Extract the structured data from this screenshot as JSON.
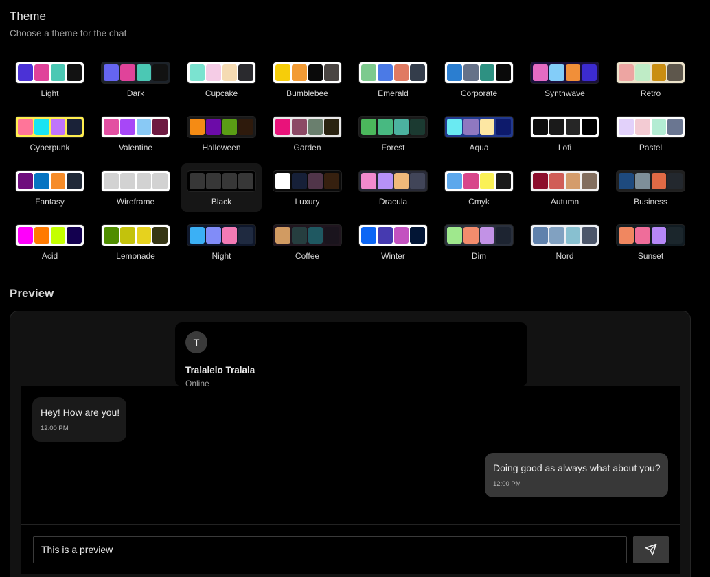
{
  "header": {
    "title": "Theme",
    "subtitle": "Choose a theme for the chat"
  },
  "themes": [
    {
      "name": "Light",
      "colors": [
        "#4b32d6",
        "#e0439a",
        "#4bc8b4",
        "#121212"
      ],
      "frame": "#ffffff"
    },
    {
      "name": "Dark",
      "colors": [
        "#6565f0",
        "#e0439a",
        "#4bc8b4",
        "#121212"
      ],
      "frame": "#1d232a"
    },
    {
      "name": "Cupcake",
      "colors": [
        "#7be3d0",
        "#f5cce6",
        "#f5dbb3",
        "#2a2a2e"
      ],
      "frame": "#ffffff"
    },
    {
      "name": "Bumblebee",
      "colors": [
        "#f6cd0a",
        "#f29b35",
        "#0a0a0a",
        "#4a4542"
      ],
      "frame": "#ffffff"
    },
    {
      "name": "Emerald",
      "colors": [
        "#7dca8e",
        "#4b7ae6",
        "#e07a62",
        "#343d4b"
      ],
      "frame": "#ffffff"
    },
    {
      "name": "Corporate",
      "colors": [
        "#2b7ed0",
        "#667289",
        "#2e9182",
        "#0a0a0a"
      ],
      "frame": "#ffffff"
    },
    {
      "name": "Synthwave",
      "colors": [
        "#e46bc3",
        "#83cdf9",
        "#f18f39",
        "#3c2bd0"
      ],
      "frame": "#1a103c"
    },
    {
      "name": "Retro",
      "colors": [
        "#eda5a2",
        "#bfecc6",
        "#c98d12",
        "#5e574c"
      ],
      "frame": "#ece3ca"
    },
    {
      "name": "Cyberpunk",
      "colors": [
        "#ff7599",
        "#19e3f2",
        "#c074fb",
        "#1a2238"
      ],
      "frame": "#ffee4f"
    },
    {
      "name": "Valentine",
      "colors": [
        "#e34fa2",
        "#a747f7",
        "#89c9f5",
        "#6e1a41"
      ],
      "frame": "#ffffff"
    },
    {
      "name": "Halloween",
      "colors": [
        "#f58b14",
        "#6c0ba8",
        "#5a9d15",
        "#2e1a0c"
      ],
      "frame": "#1a1a1a"
    },
    {
      "name": "Garden",
      "colors": [
        "#e9127a",
        "#8c4965",
        "#6a7f6e",
        "#2a2311"
      ],
      "frame": "#e8e8e8"
    },
    {
      "name": "Forest",
      "colors": [
        "#4bb85c",
        "#48b981",
        "#4cb2a0",
        "#1b3a31"
      ],
      "frame": "#1a1a1a"
    },
    {
      "name": "Aqua",
      "colors": [
        "#6aeaf2",
        "#9078c0",
        "#fde7a3",
        "#0d1a6b"
      ],
      "frame": "#22398d"
    },
    {
      "name": "Lofi",
      "colors": [
        "#0d0d0d",
        "#1a1a1a",
        "#262626",
        "#000000"
      ],
      "frame": "#ffffff"
    },
    {
      "name": "Pastel",
      "colors": [
        "#e2d1fa",
        "#f3cbd3",
        "#b3ecd3",
        "#6a7691"
      ],
      "frame": "#ffffff"
    },
    {
      "name": "Fantasy",
      "colors": [
        "#6e0e7d",
        "#0674c2",
        "#f68c29",
        "#202938"
      ],
      "frame": "#ffffff"
    },
    {
      "name": "Wireframe",
      "colors": [
        "#d2d2d2",
        "#d2d2d2",
        "#d2d2d2",
        "#d2d2d2"
      ],
      "frame": "#ffffff"
    },
    {
      "name": "Black",
      "colors": [
        "#373737",
        "#373737",
        "#373737",
        "#373737"
      ],
      "frame": "#000000"
    },
    {
      "name": "Luxury",
      "colors": [
        "#ffffff",
        "#162038",
        "#503549",
        "#36200f"
      ],
      "frame": "#0a0a0a"
    },
    {
      "name": "Dracula",
      "colors": [
        "#f28acd",
        "#b791f7",
        "#f0b97a",
        "#414558"
      ],
      "frame": "#282a36"
    },
    {
      "name": "Cmyk",
      "colors": [
        "#5da8ec",
        "#d8478b",
        "#faf157",
        "#1a1a1a"
      ],
      "frame": "#ffffff"
    },
    {
      "name": "Autumn",
      "colors": [
        "#8c0e2c",
        "#d05d57",
        "#d49c6b",
        "#826e5e"
      ],
      "frame": "#f1f1f1"
    },
    {
      "name": "Business",
      "colors": [
        "#1e4a7e",
        "#7e8f99",
        "#e06a45",
        "#23282e"
      ],
      "frame": "#202020"
    },
    {
      "name": "Acid",
      "colors": [
        "#ff00fb",
        "#ff7a00",
        "#c4ff00",
        "#13004f"
      ],
      "frame": "#fafafa"
    },
    {
      "name": "Lemonade",
      "colors": [
        "#4f8d00",
        "#c3c20c",
        "#e6d21e",
        "#363614"
      ],
      "frame": "#ffffff"
    },
    {
      "name": "Night",
      "colors": [
        "#3bb0f5",
        "#818cf8",
        "#f27ab5",
        "#1f2a40"
      ],
      "frame": "#0f172a"
    },
    {
      "name": "Coffee",
      "colors": [
        "#d19b62",
        "#263e3f",
        "#1f5861",
        "#1a141d"
      ],
      "frame": "#20161f"
    },
    {
      "name": "Winter",
      "colors": [
        "#0c66f5",
        "#463ab0",
        "#c352c0",
        "#021535"
      ],
      "frame": "#ffffff"
    },
    {
      "name": "Dim",
      "colors": [
        "#9fe88d",
        "#f28c6d",
        "#c292e6",
        "#1d2431"
      ],
      "frame": "#2a303c"
    },
    {
      "name": "Nord",
      "colors": [
        "#5f81ac",
        "#81a1c1",
        "#88c0d0",
        "#4c566a"
      ],
      "frame": "#eceff4"
    },
    {
      "name": "Sunset",
      "colors": [
        "#f08760",
        "#ef6d9a",
        "#b587f6",
        "#1b262c"
      ],
      "frame": "#121c22"
    }
  ],
  "selected_theme": "Black",
  "preview": {
    "title": "Preview",
    "contact": {
      "initial": "T",
      "name": "Tralalelo Tralala",
      "status": "Online"
    },
    "messages": [
      {
        "text": "Hey! How are you!",
        "time": "12:00 PM"
      },
      {
        "text": "Doing good as always what about you?",
        "time": "12:00 PM"
      }
    ],
    "composer_value": "This is a preview",
    "send_icon": "send-icon"
  }
}
